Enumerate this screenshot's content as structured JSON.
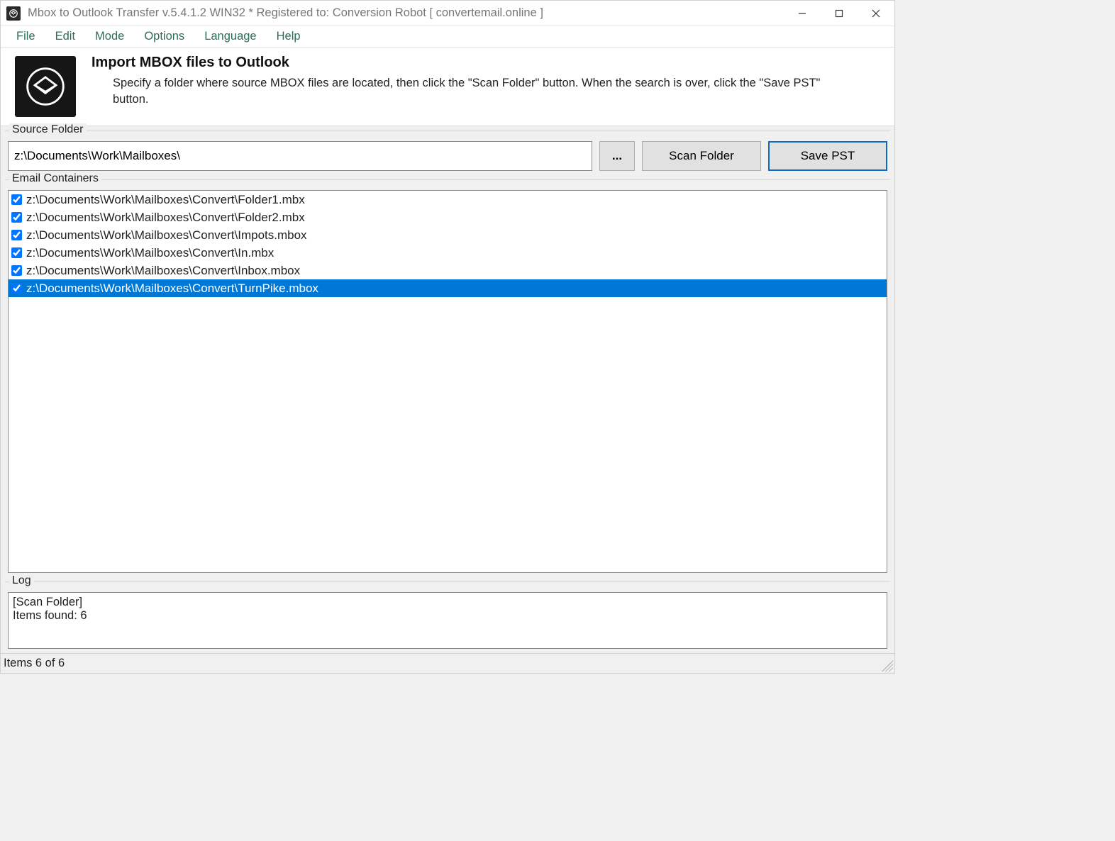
{
  "window": {
    "title": "Mbox to Outlook Transfer v.5.4.1.2 WIN32 * Registered to: Conversion Robot [ convertemail.online ]"
  },
  "menu": {
    "items": [
      "File",
      "Edit",
      "Mode",
      "Options",
      "Language",
      "Help"
    ]
  },
  "header": {
    "title": "Import MBOX files to Outlook",
    "description": "Specify a folder where source MBOX files are located, then click the \"Scan Folder\" button. When the search is over, click the \"Save PST\" button."
  },
  "source": {
    "group_label": "Source Folder",
    "path": "z:\\Documents\\Work\\Mailboxes\\",
    "browse_label": "...",
    "scan_label": "Scan Folder",
    "save_label": "Save PST"
  },
  "containers": {
    "group_label": "Email Containers",
    "items": [
      {
        "checked": true,
        "selected": false,
        "path": "z:\\Documents\\Work\\Mailboxes\\Convert\\Folder1.mbx"
      },
      {
        "checked": true,
        "selected": false,
        "path": "z:\\Documents\\Work\\Mailboxes\\Convert\\Folder2.mbx"
      },
      {
        "checked": true,
        "selected": false,
        "path": "z:\\Documents\\Work\\Mailboxes\\Convert\\Impots.mbox"
      },
      {
        "checked": true,
        "selected": false,
        "path": "z:\\Documents\\Work\\Mailboxes\\Convert\\In.mbx"
      },
      {
        "checked": true,
        "selected": false,
        "path": "z:\\Documents\\Work\\Mailboxes\\Convert\\Inbox.mbox"
      },
      {
        "checked": true,
        "selected": true,
        "path": "z:\\Documents\\Work\\Mailboxes\\Convert\\TurnPike.mbox"
      }
    ]
  },
  "log": {
    "group_label": "Log",
    "lines": [
      "[Scan Folder]",
      "Items found: 6"
    ]
  },
  "status": {
    "text": "Items 6 of 6"
  }
}
